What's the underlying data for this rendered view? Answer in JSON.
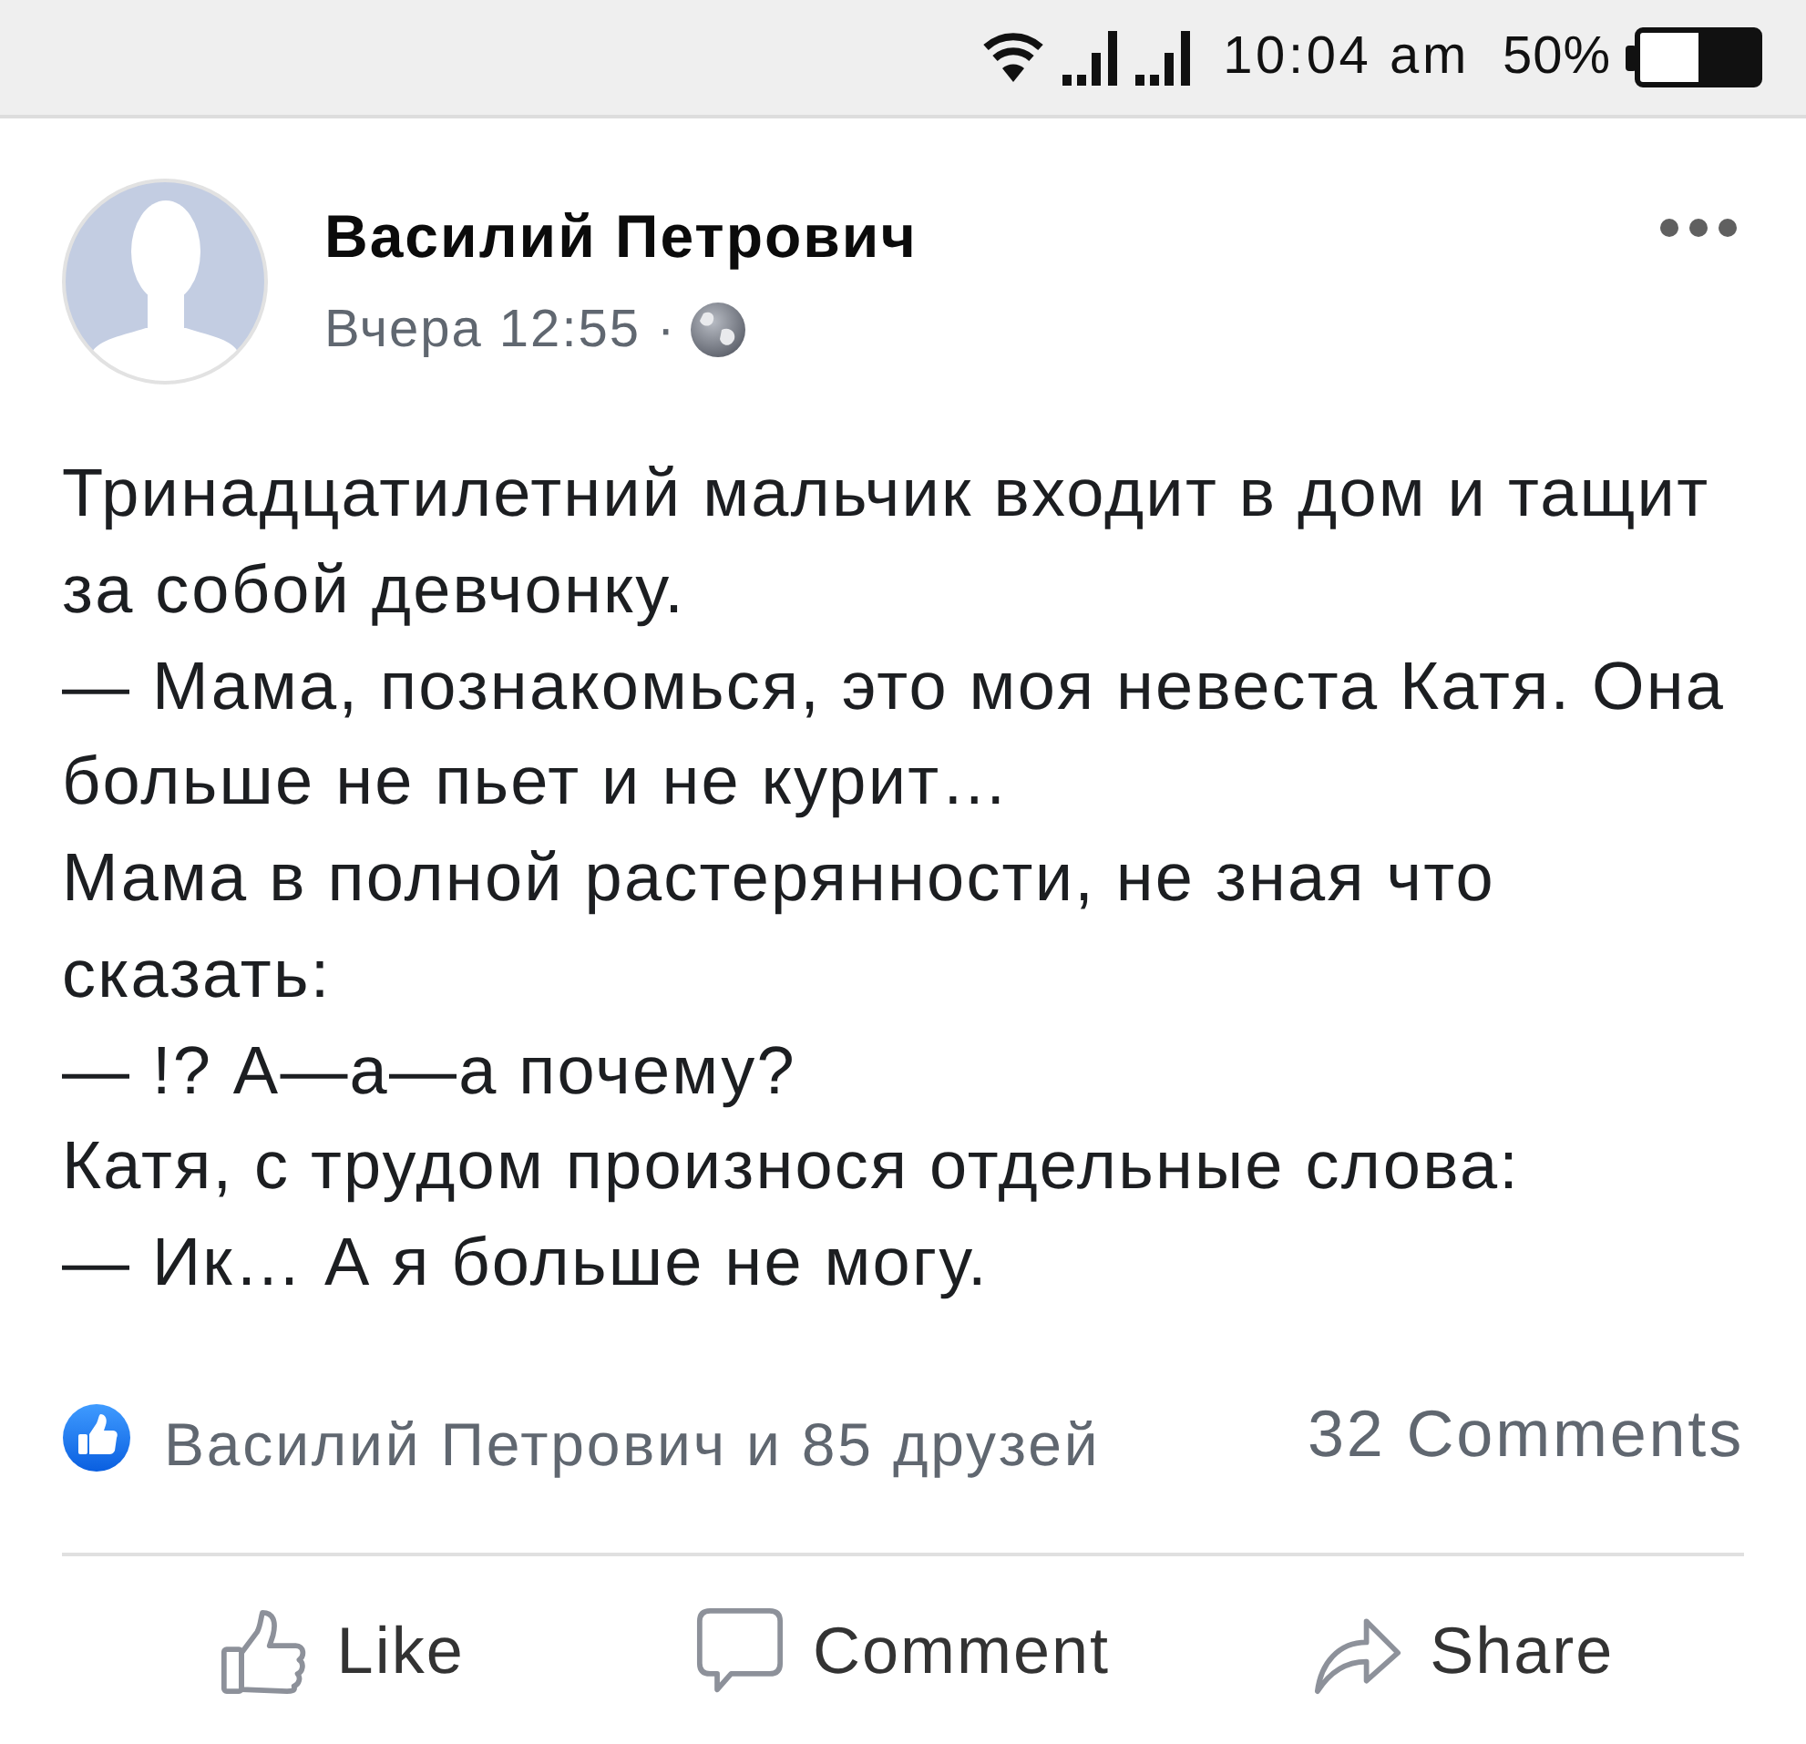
{
  "status_bar": {
    "time": "10:04 am",
    "battery": "50%"
  },
  "post": {
    "author": "Василий Петрович",
    "time": "Вчера 12:55 ·",
    "paragraphs": [
      "Тринадцатилетний мальчик входит в дом и тащит за собой девчонку.",
      "— Мама, познакомься, это моя невеста Катя. Она больше не пьет и не курит…",
      "Мама в полной растерянности, не зная что сказать:",
      "— !? А—а—а почему?",
      "Катя, с трудом произнося отдельные слова:",
      "— Ик… А я больше не могу."
    ]
  },
  "reactions": {
    "likes": "Василий Петрович и 85 друзей",
    "comments": "32 Comments"
  },
  "actions": [
    {
      "kind": "like",
      "label": "Like"
    },
    {
      "kind": "comment",
      "label": "Comment"
    },
    {
      "kind": "share",
      "label": "Share"
    }
  ]
}
